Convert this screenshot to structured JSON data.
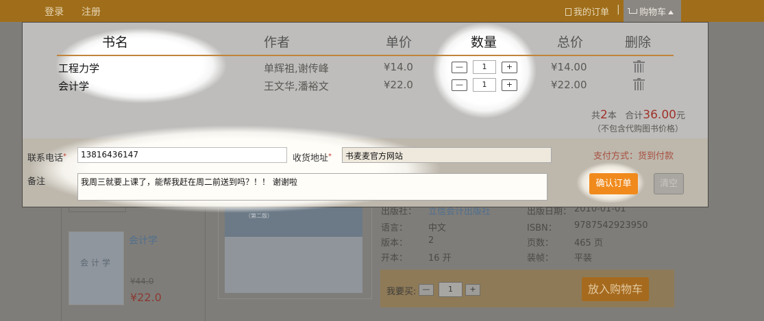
{
  "topbar": {
    "login": "登录",
    "register": "注册",
    "my_orders": "我的订单",
    "separator": "|",
    "cart": "购物车",
    "colors": {
      "bar": "#a06e1a",
      "cart_tab": "#8a8682"
    }
  },
  "product_page": {
    "related_book": {
      "title": "会计学",
      "cover_text": "会计学",
      "old_price": "¥44.0",
      "new_price": "¥22.0"
    },
    "cover_edition": "（第二版）",
    "details": [
      {
        "label": "出版社：",
        "value": "立信会计出版社"
      },
      {
        "label": "出版日期：",
        "value": "2010-01-01"
      },
      {
        "label": "语言：",
        "value": "中文"
      },
      {
        "label": "ISBN：",
        "value": "9787542923950"
      },
      {
        "label": "版本：",
        "value": "2"
      },
      {
        "label": "页数：",
        "value": "465 页"
      },
      {
        "label": "开本：",
        "value": "16 开"
      },
      {
        "label": "装帧：",
        "value": "平装"
      }
    ],
    "buy": {
      "label": "我要买:",
      "minus": "—",
      "qty": "1",
      "plus": "+",
      "add_to_cart": "放入购物车"
    }
  },
  "cart": {
    "headers": {
      "name": "书名",
      "author": "作者",
      "unit_price": "单价",
      "quantity": "数量",
      "total": "总价",
      "delete": "删除"
    },
    "items": [
      {
        "name": "工程力学",
        "author": "单辉祖,谢传峰",
        "unit_price": "¥14.0",
        "qty": "1",
        "total": "¥14.00"
      },
      {
        "name": "会计学",
        "author": "王文华,潘裕文",
        "unit_price": "¥22.0",
        "qty": "1",
        "total": "¥22.00"
      }
    ],
    "qty_minus": "—",
    "qty_plus": "+",
    "summary": {
      "prefix": "共",
      "count": "2",
      "count_unit": "本",
      "total_label": "合计",
      "total": "36.00",
      "currency_unit": "元",
      "note": "（不包含代购图书价格）"
    },
    "form": {
      "phone_label": "联系电话",
      "phone_value": "13816436147",
      "address_label": "收货地址",
      "address_value": "书麦麦官方网站",
      "note_label": "备注",
      "note_value": "我周三就要上课了，能帮我赶在周二前送到吗？！！ 谢谢啦",
      "required_mark": "*",
      "payment": "支付方式：货到付款",
      "confirm": "确认订单",
      "clear": "清空"
    },
    "colors": {
      "accent": "#f08a1c",
      "price_red": "#a0332b",
      "header_line": "#c0843a"
    }
  }
}
